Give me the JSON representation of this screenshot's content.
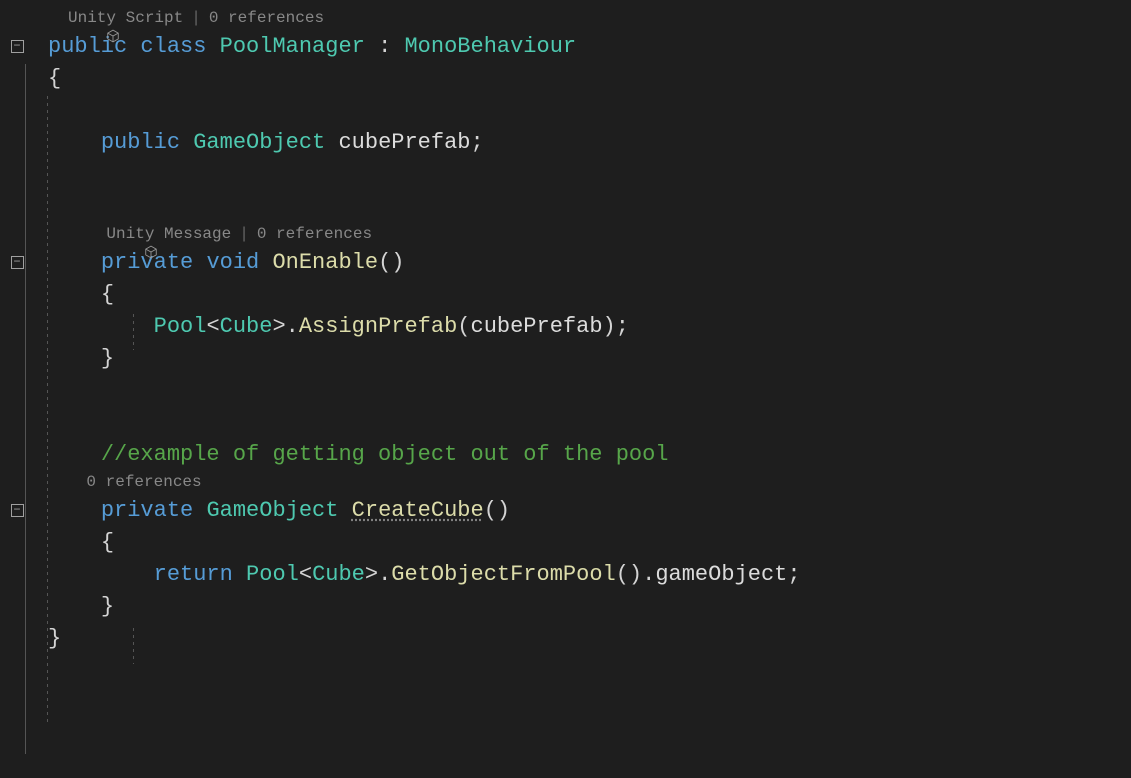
{
  "codelens": {
    "class": {
      "icon": "cube",
      "label": "Unity Script",
      "refs": "0 references"
    },
    "onenable": {
      "icon": "cube",
      "label": "Unity Message",
      "refs": "0 references"
    },
    "createcube": {
      "refs": "0 references"
    }
  },
  "tokens": {
    "public": "public",
    "class": "class",
    "private": "private",
    "void": "void",
    "return": "return",
    "PoolManager": "PoolManager",
    "MonoBehaviour": "MonoBehaviour",
    "GameObject": "GameObject",
    "cubePrefab": "cubePrefab",
    "OnEnable": "OnEnable",
    "Pool": "Pool",
    "Cube": "Cube",
    "AssignPrefab": "AssignPrefab",
    "CreateCube": "CreateCube",
    "GetObjectFromPool": "GetObjectFromPool",
    "gameObject": "gameObject",
    "comment": "//example of getting object out of the pool"
  },
  "punct": {
    "colon": " : ",
    "openParen": "(",
    "closeParen": ")",
    "openBrace": "{",
    "closeBrace": "}",
    "semicolon": ";",
    "dot": ".",
    "lt": "<",
    "gt": ">",
    "space": " "
  }
}
